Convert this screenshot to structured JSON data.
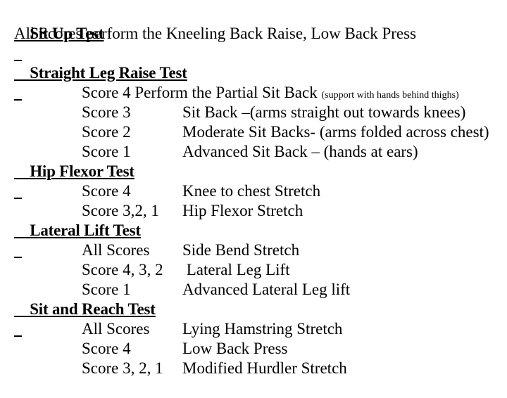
{
  "document": {
    "sections": [
      {
        "heading": "Sit Up Test",
        "subtitle": "All Scores perform the Kneeling Back Raise, Low Back Press",
        "rows": []
      },
      {
        "heading": "Straight Leg Raise Test",
        "subtitle": "",
        "rows": [
          {
            "score": "Score 4",
            "desc": "Perform the Partial Sit Back",
            "note": "(support with hands behind thighs)",
            "layout": "tight"
          },
          {
            "score": "Score 3",
            "desc": "Sit Back –(arms straight out towards knees)",
            "note": "",
            "layout": "column"
          },
          {
            "score": "Score 2",
            "desc": "Moderate Sit Backs- (arms folded across chest)",
            "note": "",
            "layout": "column"
          },
          {
            "score": "Score 1",
            "desc": "Advanced Sit Back – (hands at ears)",
            "note": "",
            "layout": "column"
          }
        ]
      },
      {
        "heading": "Hip Flexor Test",
        "subtitle": "",
        "rows": [
          {
            "score": "Score 4",
            "desc": "Knee to chest Stretch",
            "note": "",
            "layout": "column"
          },
          {
            "score": "Score 3,2, 1",
            "desc": "Hip Flexor Stretch",
            "note": "",
            "layout": "column"
          }
        ]
      },
      {
        "heading": "Lateral Lift Test",
        "subtitle": "",
        "rows": [
          {
            "score": "All Scores",
            "desc": "Side Bend Stretch",
            "note": "",
            "layout": "column"
          },
          {
            "score": "Score 4, 3, 2",
            "desc": " Lateral Leg Lift",
            "note": "",
            "layout": "column"
          },
          {
            "score": "Score 1",
            "desc": "Advanced Lateral Leg lift",
            "note": "",
            "layout": "column"
          }
        ]
      },
      {
        "heading": "Sit and Reach Test",
        "subtitle": "",
        "rows": [
          {
            "score": "All Scores",
            "desc": "Lying Hamstring Stretch",
            "note": "",
            "layout": "column"
          },
          {
            "score": "Score 4",
            "desc": "Low Back Press",
            "note": "",
            "layout": "column"
          },
          {
            "score": "Score 3, 2, 1",
            "desc": "Modified Hurdler Stretch",
            "note": "",
            "layout": "column"
          }
        ]
      }
    ]
  },
  "colors": {
    "background": "#ffffff",
    "text": "#000000"
  }
}
